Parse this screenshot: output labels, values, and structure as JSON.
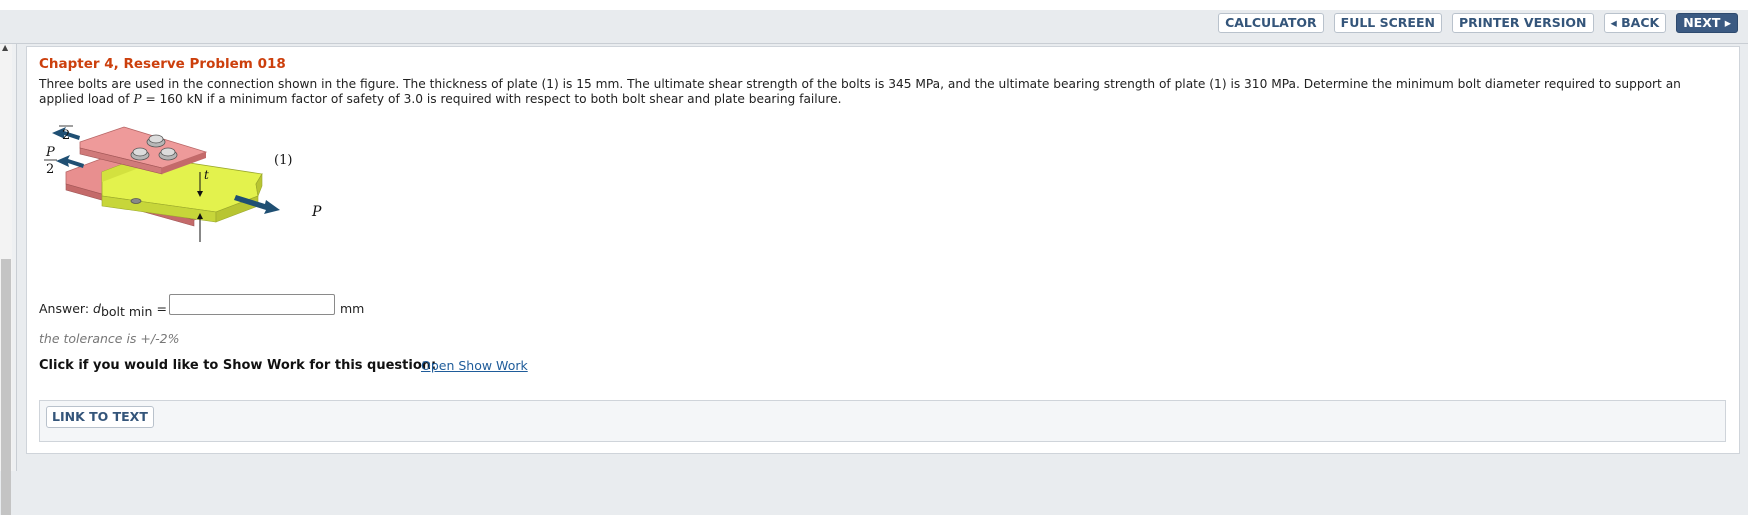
{
  "toolbar": {
    "calculator": "CALCULATOR",
    "full_screen": "FULL SCREEN",
    "printer_version": "PRINTER VERSION",
    "back": "◂ BACK",
    "next": "NEXT ▸"
  },
  "problem": {
    "title": "Chapter 4, Reserve Problem 018",
    "text_part1": "Three bolts are used in the connection shown in the figure. The thickness of plate (1) is 15 mm. The ultimate shear strength of the bolts is 345 MPa, and the ultimate bearing strength of plate (1) is 310 MPa. Determine the minimum bolt diameter required to support an applied load of ",
    "text_var": "P",
    "text_part2": " = 160 kN if a minimum factor of safety of 3.0 is required with respect to both bolt shear and plate bearing failure."
  },
  "figure": {
    "label_p_half": "P",
    "label_two": "2",
    "label_plate": "(1)",
    "label_t": "t",
    "label_p": "P"
  },
  "answer": {
    "label": "Answer: ",
    "var": "d",
    "sub": "bolt min",
    "equals": " =",
    "value": "",
    "unit": "mm"
  },
  "tolerance": "the tolerance is +/-2%",
  "show_work": {
    "label": "Click if you would like to Show Work for this question:",
    "link": "Open Show Work"
  },
  "link_to_text": "LINK TO TEXT",
  "colors": {
    "title": "#cc3f0c",
    "button_text": "#34557a",
    "next_bg": "#3b5a82",
    "link": "#1f5c9a"
  }
}
